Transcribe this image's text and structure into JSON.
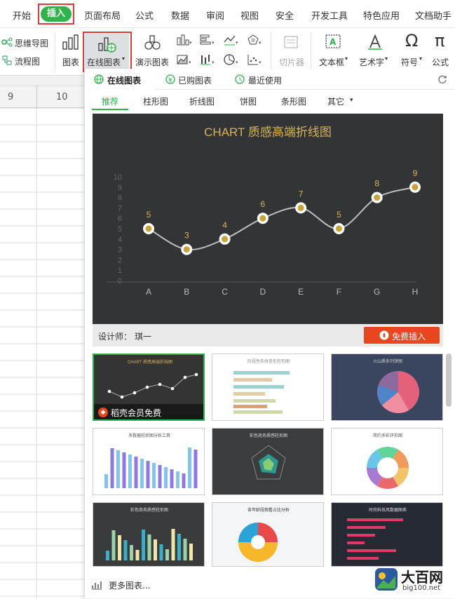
{
  "tabs": [
    "开始",
    "插入",
    "页面布局",
    "公式",
    "数据",
    "审阅",
    "视图",
    "安全",
    "开发工具",
    "特色应用",
    "文档助手"
  ],
  "ribbon": {
    "mindmap": "思维导图",
    "flowchart": "流程图",
    "chart": "图表",
    "online_chart": "在线图表",
    "demo_chart": "演示图表",
    "slicer": "切片器",
    "textbox": "文本框",
    "wordart": "艺术字",
    "symbol": "符号",
    "formula": "公式"
  },
  "sheet": {
    "col9": "9",
    "col10": "10"
  },
  "panel": {
    "tab_online": "在线图表",
    "tab_bought": "已购图表",
    "tab_recent": "最近使用",
    "cat": [
      "推荐",
      "柱形图",
      "折线图",
      "饼图",
      "条形图",
      "其它"
    ],
    "designer_label": "设计师：",
    "designer": "琪一",
    "free_insert": "免费插入",
    "member_free": "稻壳会员免费",
    "more_charts": "更多图表..."
  },
  "chart_data": {
    "type": "line",
    "title": "CHART 质感高端折线图",
    "categories": [
      "A",
      "B",
      "C",
      "D",
      "E",
      "F",
      "G",
      "H"
    ],
    "values": [
      5,
      3,
      4,
      6,
      7,
      5,
      8,
      9
    ],
    "ylim": [
      0,
      10
    ],
    "yticks": [
      "0",
      "1",
      "2",
      "3",
      "4",
      "5",
      "6",
      "7",
      "8",
      "9",
      "10"
    ]
  },
  "thumbs": [
    {
      "title": "CHART 质感高端折线图"
    },
    {
      "title": "阶段性条纹条形柱形图"
    },
    {
      "title": "火山质系列饼图"
    },
    {
      "title": "多数据柱状图分析工具"
    },
    {
      "title": "彩色商务质感柱形图"
    },
    {
      "title": "简约多彩环形图"
    },
    {
      "title": "彩色商务质感柱形图"
    },
    {
      "title": "各年龄段观看占比分析"
    },
    {
      "title": "时尚科技风数据图表"
    }
  ],
  "logo": {
    "text": "大百网",
    "sub": "big100.net"
  },
  "colors": {
    "insert_green": "#2fb44a",
    "red_highlight": "#e23a3a",
    "chart_bg": "#333435",
    "gold": "#d4b35a",
    "insert_orange": "#e8461d"
  }
}
